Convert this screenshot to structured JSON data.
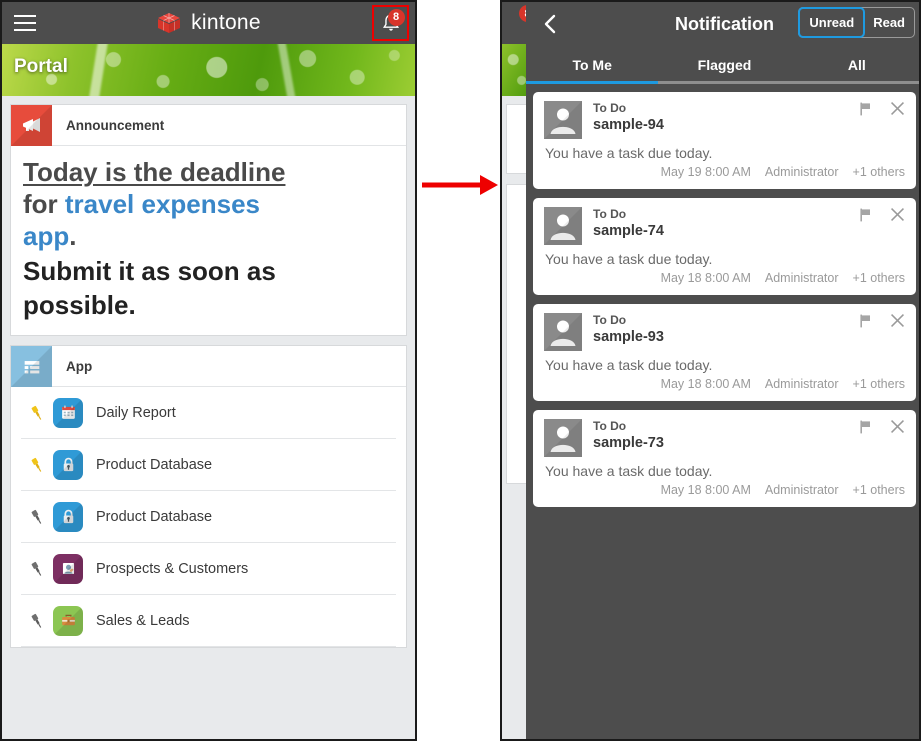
{
  "left_panel": {
    "topbar": {
      "menu_icon": "hamburger-icon",
      "brand": "kintone",
      "logo_icon": "kintone-cube-logo",
      "bell_icon": "bell-icon",
      "badge_count": "8",
      "highlight_color": "#ee0000",
      "bar_color": "#4d4d4d"
    },
    "hero": {
      "title": "Portal"
    },
    "announcement": {
      "header": "Announcement",
      "header_icon": "megaphone-icon",
      "header_icon_color": "#e74c3c",
      "line1": "Today is the deadline",
      "line2_prefix": "for ",
      "line2_link": "travel expenses",
      "line3_link": "app",
      "line3_suffix": ".",
      "line4": "Submit it as soon as",
      "line5": "possible.",
      "link_color": "#3a87c8"
    },
    "apps": {
      "header": "App",
      "header_icon": "list-icon",
      "header_icon_color": "#87c0e0",
      "items": [
        {
          "label": "Daily Report",
          "pin": "pin-icon",
          "pinned": true,
          "icon": "calendar-icon",
          "icon_color": "#2f9ad6"
        },
        {
          "label": "Product Database",
          "pin": "pin-icon",
          "pinned": true,
          "icon": "lock-icon",
          "icon_color": "#2f9ad6"
        },
        {
          "label": "Product Database",
          "pin": "pin-icon",
          "pinned": false,
          "icon": "lock-icon",
          "icon_color": "#2f9ad6"
        },
        {
          "label": "Prospects & Customers",
          "pin": "pin-icon",
          "pinned": false,
          "icon": "customer-icon",
          "icon_color": "#7d2f63"
        },
        {
          "label": "Sales & Leads",
          "pin": "pin-icon",
          "pinned": false,
          "icon": "briefcase-icon",
          "icon_color": "#8cc653"
        }
      ]
    }
  },
  "arrow": {
    "icon": "right-arrow-annotation",
    "color": "#ee0000"
  },
  "right_panel": {
    "behind_badge": "8",
    "header": {
      "back_icon": "chevron-left-icon",
      "title": "Notification",
      "segments": [
        {
          "label": "Unread",
          "active": true
        },
        {
          "label": "Read",
          "active": false
        }
      ],
      "active_color": "#1e9ae0"
    },
    "tabs": [
      {
        "label": "To Me",
        "active": true
      },
      {
        "label": "Flagged",
        "active": false
      },
      {
        "label": "All",
        "active": false
      }
    ],
    "notifications": [
      {
        "avatar": "user-avatar",
        "kind": "To Do",
        "subject": "sample-94",
        "message": "You have a task due today.",
        "time": "May 19 8:00 AM",
        "author": "Administrator",
        "others": "+1 others",
        "flag_icon": "flag-icon",
        "close_icon": "close-icon"
      },
      {
        "avatar": "user-avatar",
        "kind": "To Do",
        "subject": "sample-74",
        "message": "You have a task due today.",
        "time": "May 18 8:00 AM",
        "author": "Administrator",
        "others": "+1 others",
        "flag_icon": "flag-icon",
        "close_icon": "close-icon"
      },
      {
        "avatar": "user-avatar",
        "kind": "To Do",
        "subject": "sample-93",
        "message": "You have a task due today.",
        "time": "May 18 8:00 AM",
        "author": "Administrator",
        "others": "+1 others",
        "flag_icon": "flag-icon",
        "close_icon": "close-icon"
      },
      {
        "avatar": "user-avatar",
        "kind": "To Do",
        "subject": "sample-73",
        "message": "You have a task due today.",
        "time": "May 18 8:00 AM",
        "author": "Administrator",
        "others": "+1 others",
        "flag_icon": "flag-icon",
        "close_icon": "close-icon"
      }
    ]
  }
}
